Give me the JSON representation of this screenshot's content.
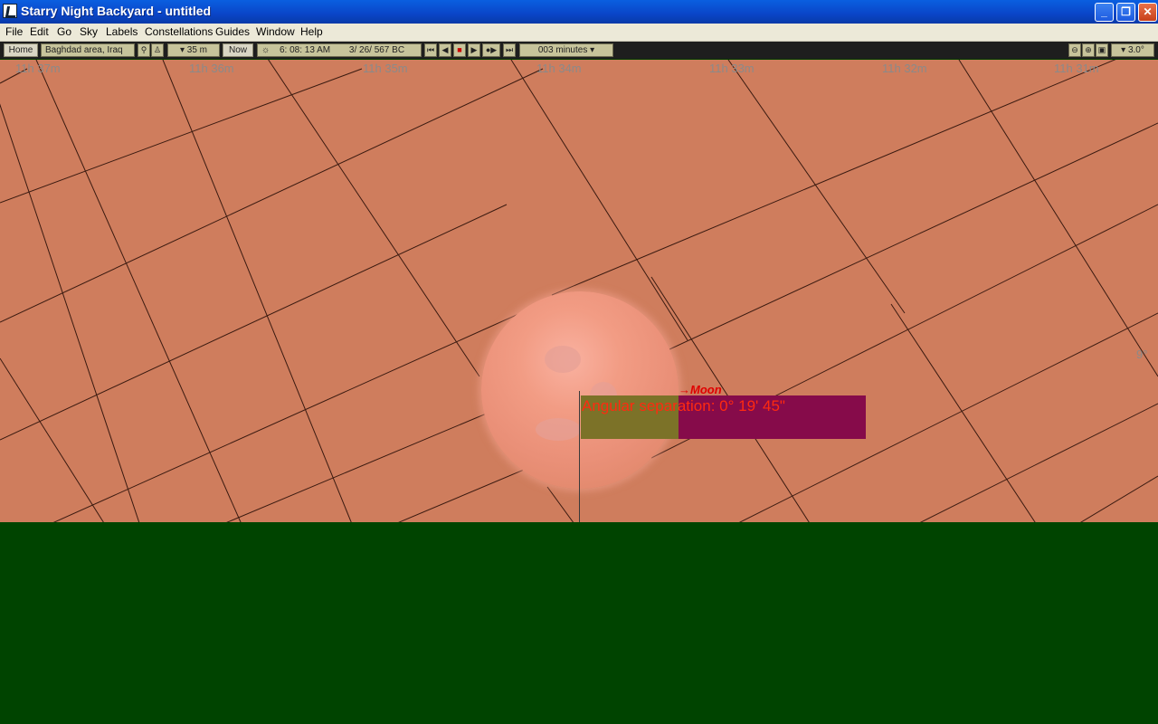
{
  "window": {
    "title": "Starry Night Backyard - untitled"
  },
  "menu": [
    "File",
    "Edit",
    "Go",
    "Sky",
    "Labels",
    "Constellations",
    "Guides",
    "Window",
    "Help"
  ],
  "toolbar": {
    "home_label": "Home",
    "location": "Baghdad area, Iraq",
    "elevation": "▾ 35 m",
    "now_label": "Now",
    "time": "6: 08: 13 AM",
    "date": "3/ 26/   567 BC",
    "time_step": "003 minutes ▾",
    "fov": "▾ 3.0°"
  },
  "sky": {
    "ra_labels": [
      "11h 37m",
      "11h 36m",
      "11h 35m",
      "11h 34m",
      "11h 33m",
      "11h 32m",
      "11h 31m"
    ],
    "dec_label": "9°",
    "object_label": "→Moon",
    "separation_text": "Angular separation: 0° 19' 45\""
  },
  "colors": {
    "sky": "#cf7d5d",
    "ground": "#004400",
    "label_red": "#e00000",
    "box": "#860b4a"
  }
}
